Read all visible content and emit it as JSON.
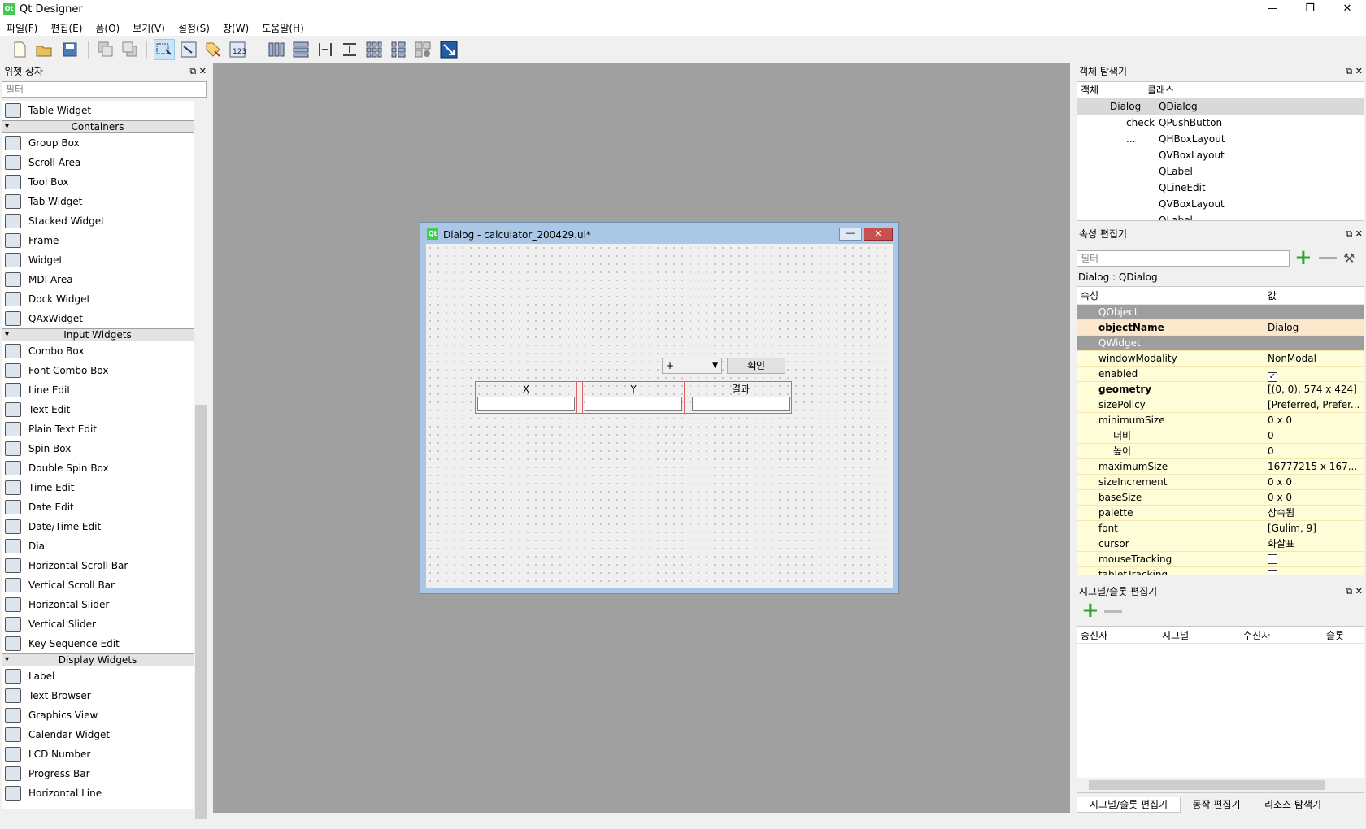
{
  "window": {
    "title": "Qt Designer",
    "minimize": "—",
    "restore": "❐",
    "close": "✕"
  },
  "menu": [
    "파일(F)",
    "편집(E)",
    "폼(O)",
    "보기(V)",
    "설정(S)",
    "창(W)",
    "도움말(H)"
  ],
  "widget_box": {
    "title": "위젯 상자",
    "filter_placeholder": "필터",
    "top_item": "Table Widget",
    "containers_label": "Containers",
    "containers": [
      "Group Box",
      "Scroll Area",
      "Tool Box",
      "Tab Widget",
      "Stacked Widget",
      "Frame",
      "Widget",
      "MDI Area",
      "Dock Widget",
      "QAxWidget"
    ],
    "input_label": "Input Widgets",
    "inputs": [
      "Combo Box",
      "Font Combo Box",
      "Line Edit",
      "Text Edit",
      "Plain Text Edit",
      "Spin Box",
      "Double Spin Box",
      "Time Edit",
      "Date Edit",
      "Date/Time Edit",
      "Dial",
      "Horizontal Scroll Bar",
      "Vertical Scroll Bar",
      "Horizontal Slider",
      "Vertical Slider",
      "Key Sequence Edit"
    ],
    "display_label": "Display Widgets",
    "displays": [
      "Label",
      "Text Browser",
      "Graphics View",
      "Calendar Widget",
      "LCD Number",
      "Progress Bar",
      "Horizontal Line"
    ]
  },
  "dialog": {
    "title": "Dialog - calculator_200429.ui*",
    "combo_value": "+",
    "button_label": "확인",
    "col_x": "X",
    "col_y": "Y",
    "col_result": "결과"
  },
  "object_inspector": {
    "title": "객체 탐색기",
    "col_object": "객체",
    "col_class": "클래스",
    "rows": [
      {
        "obj": "Dialog",
        "cls": "QDialog"
      },
      {
        "obj": "check",
        "cls": "QPushButton"
      },
      {
        "obj": "...",
        "cls": "QHBoxLayout"
      },
      {
        "obj": "",
        "cls": "QVBoxLayout"
      },
      {
        "obj": "",
        "cls": "QLabel"
      },
      {
        "obj": "",
        "cls": "QLineEdit"
      },
      {
        "obj": "",
        "cls": "QVBoxLayout"
      },
      {
        "obj": "",
        "cls": "QLabel"
      }
    ]
  },
  "property_editor": {
    "title": "속성 편집기",
    "filter_placeholder": "필터",
    "context": "Dialog : QDialog",
    "col_property": "속성",
    "col_value": "값",
    "rows": [
      {
        "name": "QObject",
        "value": ""
      },
      {
        "name": "objectName",
        "value": "Dialog"
      },
      {
        "name": "QWidget",
        "value": ""
      },
      {
        "name": "windowModality",
        "value": "NonModal"
      },
      {
        "name": "enabled",
        "value": "✓"
      },
      {
        "name": "geometry",
        "value": "[(0, 0), 574 x 424]"
      },
      {
        "name": "sizePolicy",
        "value": "[Preferred, Prefer..."
      },
      {
        "name": "minimumSize",
        "value": "0 x 0"
      },
      {
        "name": "너비",
        "value": "0"
      },
      {
        "name": "높이",
        "value": "0"
      },
      {
        "name": "maximumSize",
        "value": "16777215 x 167..."
      },
      {
        "name": "sizeIncrement",
        "value": "0 x 0"
      },
      {
        "name": "baseSize",
        "value": "0 x 0"
      },
      {
        "name": "palette",
        "value": "상속됨"
      },
      {
        "name": "font",
        "value": "[Gulim, 9]"
      },
      {
        "name": "cursor",
        "value": "화살표"
      },
      {
        "name": "mouseTracking",
        "value": ""
      },
      {
        "name": "tabletTracking",
        "value": ""
      }
    ]
  },
  "signal_slot": {
    "title": "시그널/슬롯 편집기",
    "cols": [
      "송신자",
      "시그널",
      "수신자",
      "슬롯"
    ]
  },
  "bottom_tabs": [
    "시그널/슬롯 편집기",
    "동작 편집기",
    "리소스 탐색기"
  ]
}
